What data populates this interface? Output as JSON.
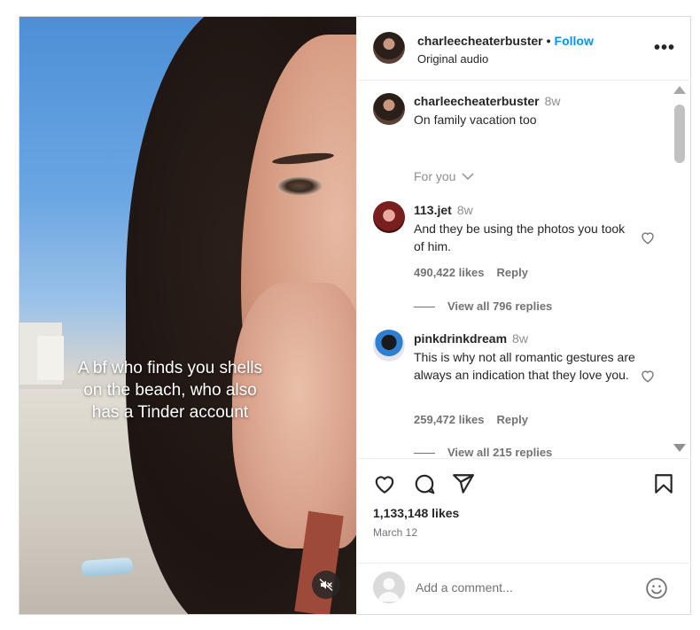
{
  "post": {
    "username": "charleecheaterbuster",
    "follow_label": "Follow",
    "audio": "Original audio",
    "more_label": "•••"
  },
  "media": {
    "overlay_lines": [
      "A bf who finds you shells",
      "on the beach, who also",
      "has a Tinder account"
    ],
    "mute_icon": "speaker-muted-icon"
  },
  "caption": {
    "username": "charleecheaterbuster",
    "time": "8w",
    "text": "On family vacation too"
  },
  "for_you": {
    "label": "For you"
  },
  "comments": [
    {
      "username": "113.jet",
      "time": "8w",
      "text": "And they be using the photos you took of him.",
      "likes": "490,422 likes",
      "reply": "Reply",
      "view_replies": "View all 796 replies"
    },
    {
      "username": "pinkdrinkdream",
      "time": "8w",
      "text": "This is why not all romantic gestures are always an indication that they love you.",
      "likes": "259,472 likes",
      "reply": "Reply",
      "view_replies": "View all 215 replies"
    }
  ],
  "actions": {
    "like_icon": "heart-icon",
    "comment_icon": "comment-icon",
    "share_icon": "share-icon",
    "save_icon": "bookmark-icon",
    "likes": "1,133,148 likes",
    "date": "March 12"
  },
  "comment_box": {
    "placeholder": "Add a comment...",
    "emoji_icon": "emoji-icon"
  },
  "colors": {
    "follow": "#0095f6",
    "text": "#262626",
    "muted": "#737373",
    "border": "#dbdbdb"
  }
}
